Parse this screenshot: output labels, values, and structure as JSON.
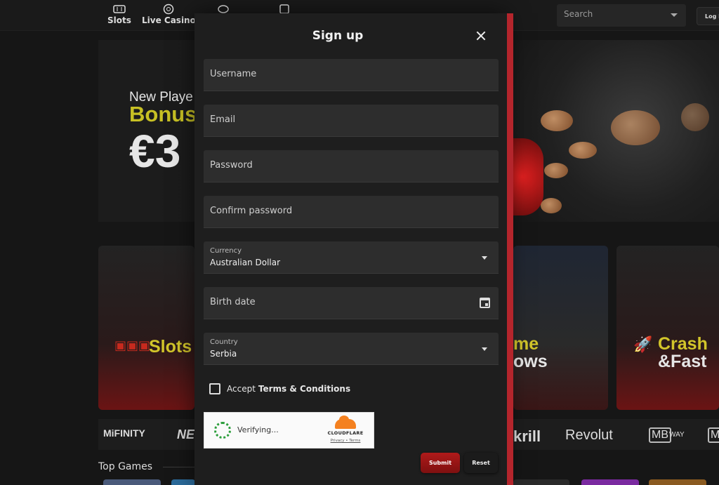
{
  "nav": {
    "slots_label": "Slots",
    "live_casino_label": "Live Casino",
    "search_placeholder": "Search",
    "login_label": "Log In"
  },
  "hero": {
    "line1": "New Playe",
    "line2": "Bonus",
    "line3": "€3"
  },
  "tiles": {
    "slots": "Slots",
    "game_shows_a": "me",
    "game_shows_b": "ows",
    "crash_a": "Crash",
    "crash_b": "&Fast"
  },
  "payments": [
    "MiFINITY",
    "NE",
    "krill",
    "Revolut",
    "MB",
    "WAY",
    "M"
  ],
  "sections": {
    "top_games": "Top Games"
  },
  "modal": {
    "title": "Sign up",
    "username_placeholder": "Username",
    "email_placeholder": "Email",
    "password_placeholder": "Password",
    "confirm_password_placeholder": "Confirm password",
    "currency_label": "Currency",
    "currency_value": "Australian Dollar",
    "birth_date_placeholder": "Birth date",
    "country_label": "Country",
    "country_value": "Serbia",
    "terms_prefix": "Accept",
    "terms_link": "Terms & Conditions",
    "captcha_status": "Verifying...",
    "captcha_brand": "CLOUDFLARE",
    "captcha_links": "Privacy • Terms",
    "submit_label": "Submit",
    "reset_label": "Reset"
  },
  "colors": {
    "accent_red": "#b4252c",
    "bonus_yellow": "#c7c024",
    "cloudflare_orange": "#f48120"
  }
}
